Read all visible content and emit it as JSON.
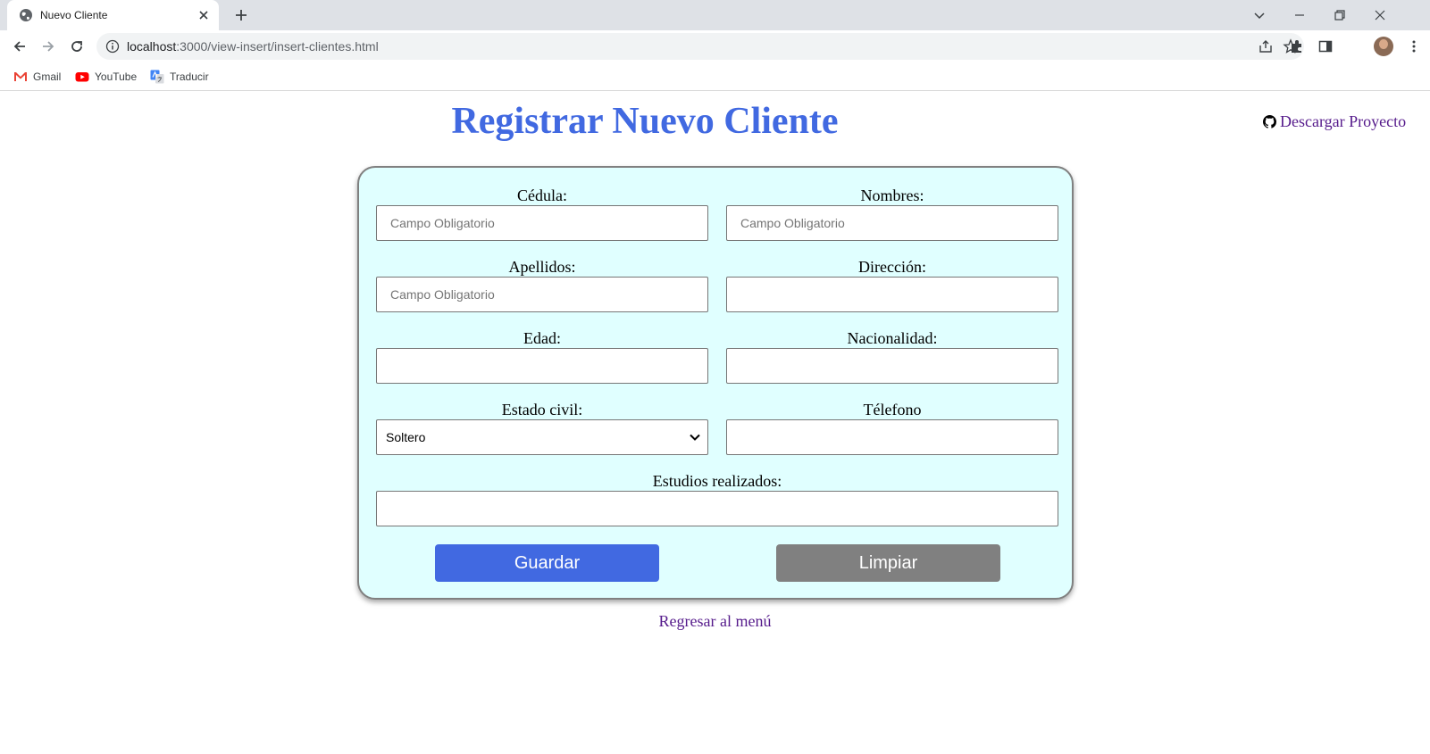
{
  "browser": {
    "tab_title": "Nuevo Cliente",
    "url_host": "localhost",
    "url_path": ":3000/view-insert/insert-clientes.html",
    "bookmarks": [
      {
        "label": "Gmail",
        "icon": "gmail-icon"
      },
      {
        "label": "YouTube",
        "icon": "youtube-icon"
      },
      {
        "label": "Traducir",
        "icon": "translate-icon"
      }
    ]
  },
  "page": {
    "title": "Registrar Nuevo Cliente",
    "download_link": "Descargar Proyecto",
    "back_link": "Regresar al menú"
  },
  "form": {
    "cedula": {
      "label": "Cédula:",
      "placeholder": "Campo Obligatorio",
      "value": ""
    },
    "nombres": {
      "label": "Nombres:",
      "placeholder": "Campo Obligatorio",
      "value": ""
    },
    "apellidos": {
      "label": "Apellidos:",
      "placeholder": "Campo Obligatorio",
      "value": ""
    },
    "direccion": {
      "label": "Dirección:",
      "value": ""
    },
    "edad": {
      "label": "Edad:",
      "value": ""
    },
    "nacionalidad": {
      "label": "Nacionalidad:",
      "value": ""
    },
    "estado_civil": {
      "label": "Estado civil:",
      "selected": "Soltero"
    },
    "telefono": {
      "label": "Télefono",
      "value": ""
    },
    "estudios": {
      "label": "Estudios realizados:",
      "value": ""
    },
    "save_label": "Guardar",
    "clear_label": "Limpiar"
  },
  "colors": {
    "title": "#4169e1",
    "card_bg": "#e0ffff",
    "save_button": "#4169e1",
    "clear_button": "#808080",
    "link": "#551a8b"
  }
}
